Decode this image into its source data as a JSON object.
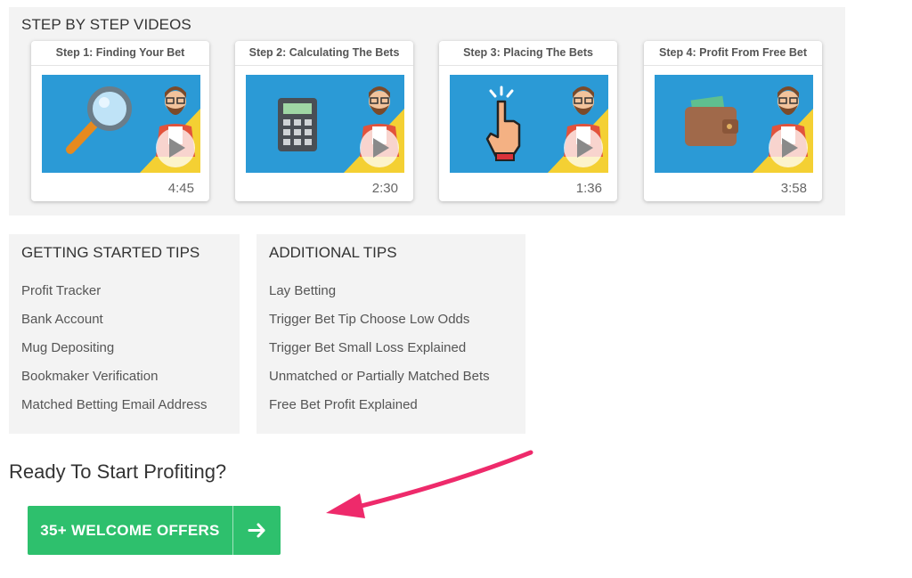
{
  "videos": {
    "title": "STEP BY STEP VIDEOS",
    "cards": [
      {
        "title": "Step 1: Finding Your Bet",
        "duration": "4:45",
        "icon": "magnifier-icon"
      },
      {
        "title": "Step 2: Calculating The Bets",
        "duration": "2:30",
        "icon": "calculator-icon"
      },
      {
        "title": "Step 3: Placing The Bets",
        "duration": "1:36",
        "icon": "pointing-hand-icon"
      },
      {
        "title": "Step 4: Profit From Free Bet",
        "duration": "3:58",
        "icon": "wallet-icon"
      }
    ]
  },
  "getting_started": {
    "title": "GETTING STARTED TIPS",
    "items": [
      "Profit Tracker",
      "Bank Account",
      "Mug Depositing",
      "Bookmaker Verification",
      "Matched Betting Email Address"
    ]
  },
  "additional": {
    "title": "ADDITIONAL TIPS",
    "items": [
      "Lay Betting",
      "Trigger Bet Tip Choose Low Odds",
      "Trigger Bet Small Loss Explained",
      "Unmatched or Partially Matched Bets",
      "Free Bet Profit Explained"
    ]
  },
  "cta": {
    "heading": "Ready To Start Profiting?",
    "button_label": "35+ WELCOME OFFERS"
  },
  "colors": {
    "thumb_blue": "#2b9ad6",
    "thumb_yellow": "#f4d033",
    "button_green": "#2ec06d",
    "arrow_pink": "#ee2a6b"
  }
}
